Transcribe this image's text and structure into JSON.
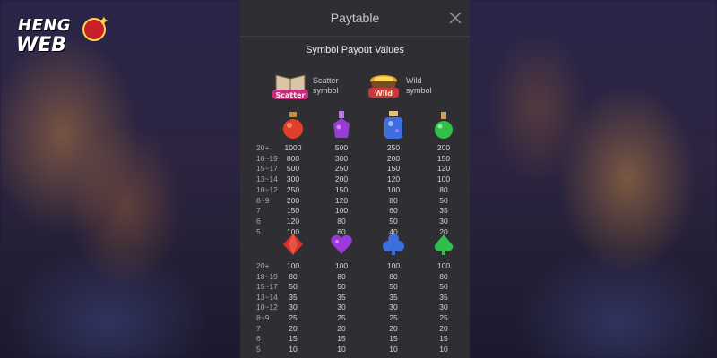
{
  "logo": {
    "line1": "HENG",
    "line2": "WEB"
  },
  "panel": {
    "title": "Paytable",
    "section_title": "Symbol Payout Values"
  },
  "specials": [
    {
      "name": "scatter",
      "label_line1": "Scatter",
      "label_line2": "symbol",
      "badge": "Scatter"
    },
    {
      "name": "wild",
      "label_line1": "Wild",
      "label_line2": "symbol",
      "badge": "Wild"
    }
  ],
  "table_top": {
    "symbols": [
      "red-potion",
      "purple-potion",
      "blue-potion",
      "green-potion"
    ],
    "rows": [
      {
        "count": "20+",
        "values": [
          "1000",
          "500",
          "250",
          "200"
        ]
      },
      {
        "count": "18~19",
        "values": [
          "800",
          "300",
          "200",
          "150"
        ]
      },
      {
        "count": "15~17",
        "values": [
          "500",
          "250",
          "150",
          "120"
        ]
      },
      {
        "count": "13~14",
        "values": [
          "300",
          "200",
          "120",
          "100"
        ]
      },
      {
        "count": "10~12",
        "values": [
          "250",
          "150",
          "100",
          "80"
        ]
      },
      {
        "count": "8~9",
        "values": [
          "200",
          "120",
          "80",
          "50"
        ]
      },
      {
        "count": "7",
        "values": [
          "150",
          "100",
          "60",
          "35"
        ]
      },
      {
        "count": "6",
        "values": [
          "120",
          "80",
          "50",
          "30"
        ]
      },
      {
        "count": "5",
        "values": [
          "100",
          "60",
          "40",
          "20"
        ]
      }
    ]
  },
  "table_bottom": {
    "symbols": [
      "red-diamond-gem",
      "purple-heart-gem",
      "blue-club-gem",
      "green-spade-gem"
    ],
    "rows": [
      {
        "count": "20+",
        "values": [
          "100",
          "100",
          "100",
          "100"
        ]
      },
      {
        "count": "18~19",
        "values": [
          "80",
          "80",
          "80",
          "80"
        ]
      },
      {
        "count": "15~17",
        "values": [
          "50",
          "50",
          "50",
          "50"
        ]
      },
      {
        "count": "13~14",
        "values": [
          "35",
          "35",
          "35",
          "35"
        ]
      },
      {
        "count": "10~12",
        "values": [
          "30",
          "30",
          "30",
          "30"
        ]
      },
      {
        "count": "8~9",
        "values": [
          "25",
          "25",
          "25",
          "25"
        ]
      },
      {
        "count": "7",
        "values": [
          "20",
          "20",
          "20",
          "20"
        ]
      },
      {
        "count": "6",
        "values": [
          "15",
          "15",
          "15",
          "15"
        ]
      },
      {
        "count": "5",
        "values": [
          "10",
          "10",
          "10",
          "10"
        ]
      }
    ]
  },
  "colors": {
    "panel_bg": "#2e2e33",
    "red": "#d8302a",
    "purple": "#9a3ad8",
    "blue": "#3d6fe0",
    "green": "#2fbf4a",
    "gold": "#e0a030"
  }
}
